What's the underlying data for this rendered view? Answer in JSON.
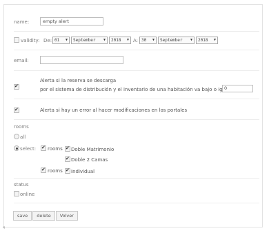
{
  "form": {
    "name_label": "name:",
    "name_value": "empty alert",
    "validity_label": "validity:",
    "from_label": "De:",
    "from_day": "01",
    "from_month": "September",
    "from_year": "2018",
    "to_label": "A:",
    "to_day": "30",
    "to_month": "September",
    "to_year": "2018",
    "email_label": "email:",
    "email_value": "",
    "alert1_line1": "Alerta si la reserva se descarga",
    "alert1_line2": "por el sistema de distribución y el inventario de una habitación va bajo o igual",
    "alert1_threshold": "0",
    "alert2_text": "Alerta si hay un error al hacer modificaciones en los portales",
    "rooms_label": "rooms",
    "all_label": "all",
    "select_label": "select:",
    "rooms_group_label": "rooms",
    "room_1": "Doble Matrimonio",
    "room_2": "Doble 2 Camas",
    "room_3": "Individual",
    "status_label": "status",
    "online_label": "online"
  },
  "buttons": {
    "save": "save",
    "delete": "delete",
    "back": "Volver"
  },
  "state": {
    "validity_checked": false,
    "alert1_checked": true,
    "alert2_checked": true,
    "rooms_mode": "select",
    "rooms_group1_checked": true,
    "room_1_checked": true,
    "room_2_checked": true,
    "rooms_group2_checked": true,
    "room_3_checked": true,
    "online_checked": false
  },
  "footer_mark": "4"
}
